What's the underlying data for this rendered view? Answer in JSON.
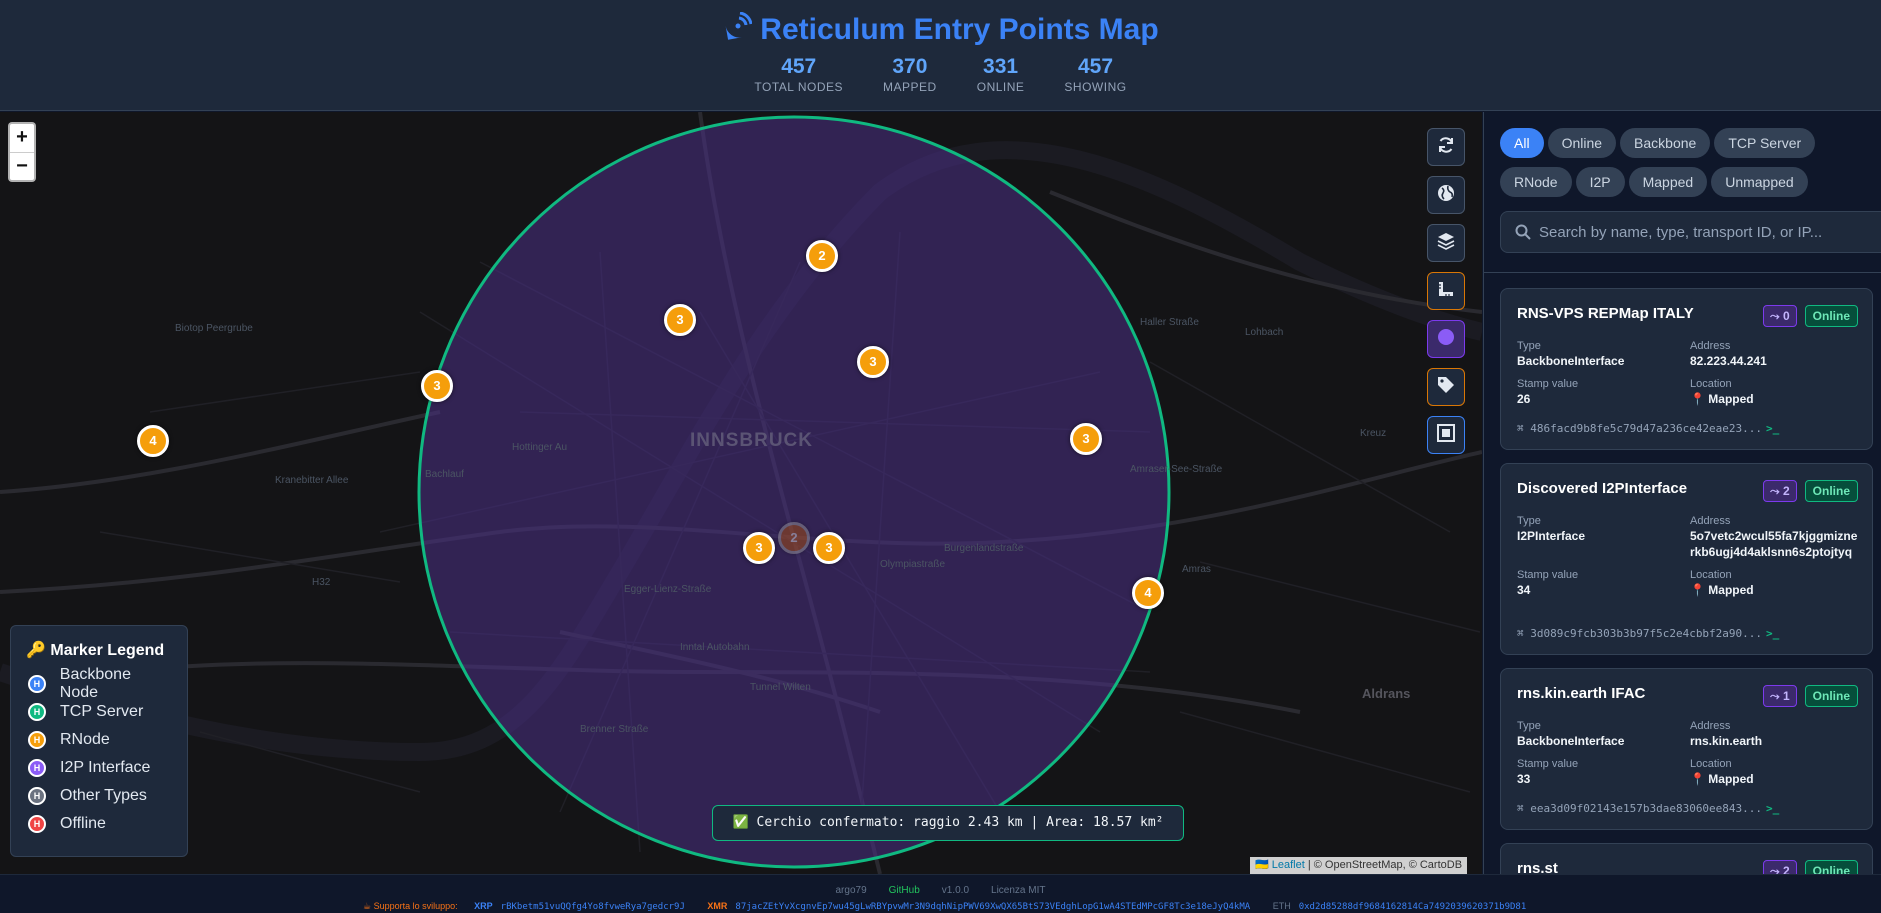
{
  "header": {
    "title": "Reticulum Entry Points Map",
    "stats": [
      {
        "value": "457",
        "label": "TOTAL NODES"
      },
      {
        "value": "370",
        "label": "MAPPED"
      },
      {
        "value": "331",
        "label": "ONLINE"
      },
      {
        "value": "457",
        "label": "SHOWING"
      }
    ]
  },
  "map": {
    "zoom_in": "+",
    "zoom_out": "−",
    "city_label": "INNSBRUCK",
    "street_labels": [
      "Biotop Peergrube",
      "Hottinger Au",
      "Bachlauf",
      "Kranebitter Allee",
      "H32",
      "Egger-Lienz-Straße",
      "Olympiastraße",
      "Burgenlandstraße",
      "Inntal Autobahn",
      "Tunnel Wilten",
      "Brenner Straße",
      "Amraser-See-Straße",
      "Haller Straße",
      "Aldrans",
      "Amras",
      "Lohbach",
      "Kreuz"
    ],
    "clusters": [
      "2",
      "3",
      "3",
      "3",
      "4",
      "3",
      "2",
      "3",
      "3",
      "4"
    ],
    "legend": {
      "title": "Marker Legend",
      "items": [
        {
          "label": "Backbone Node",
          "color": "#3b82f6"
        },
        {
          "label": "TCP Server",
          "color": "#10b981"
        },
        {
          "label": "RNode",
          "color": "#f59e0b"
        },
        {
          "label": "I2P Interface",
          "color": "#8b5cf6"
        },
        {
          "label": "Other Types",
          "color": "#6b7280"
        },
        {
          "label": "Offline",
          "color": "#ef4444"
        }
      ],
      "marker_letter": "H"
    },
    "toast": "✅ Cerchio confermato: raggio 2.43 km | Area: 18.57 km²",
    "attribution": {
      "leaflet": "Leaflet",
      "rest": "| © OpenStreetMap, © CartoDB"
    },
    "circle_color": "#10b981",
    "circle_fill": "#5b3a9e"
  },
  "sidebar": {
    "filters": [
      "All",
      "Online",
      "Backbone",
      "TCP Server",
      "RNode",
      "I2P",
      "Mapped",
      "Unmapped"
    ],
    "active_filter": "All",
    "search_placeholder": "Search by name, type, transport ID, or IP...",
    "labels": {
      "type": "Type",
      "address": "Address",
      "stamp": "Stamp value",
      "location": "Location"
    },
    "cards": [
      {
        "name": "RNS-VPS REPMap ITALY",
        "hops": "0",
        "status": "Online",
        "type": "BackboneInterface",
        "address": "82.223.44.241",
        "stamp": "26",
        "location": "📍 Mapped",
        "tid": "486facd9b8fe5c79d47a236ce42eae23..."
      },
      {
        "name": "Discovered I2PInterface",
        "hops": "2",
        "status": "Online",
        "type": "I2PInterface",
        "address": "5o7vetc2wcul55fa7kjggmiznerkb6ugj4d4aklsnn6s2ptojtyq",
        "stamp": "34",
        "location": "📍 Mapped",
        "tid": "3d089c9fcb303b3b97f5c2e4cbbf2a90..."
      },
      {
        "name": "rns.kin.earth IFAC",
        "hops": "1",
        "status": "Online",
        "type": "BackboneInterface",
        "address": "rns.kin.earth",
        "stamp": "33",
        "location": "📍 Mapped",
        "tid": "eea3d09f02143e157b3dae83060ee843..."
      },
      {
        "name": "rns.st",
        "hops": "2",
        "status": "Online"
      }
    ]
  },
  "footer": {
    "author": "argo79",
    "github": "GitHub",
    "version": "v1.0.0",
    "license": "Licenza MIT",
    "support": "☕ Supporta lo sviluppo:",
    "xrp_label": "XRP",
    "xrp_addr": "rBKbetm51vuQQfg4Yo8fvweRya7gedcr9J",
    "xmr_label": "XMR",
    "xmr_addr": "87jacZEtYvXcgnvEp7wu45gLwRBYpvwMr3N9dqhNipPWV69XwQX65BtS73VEdghLopG1wA4STEdMPcGF8Tc3e18eJyQ4kMA",
    "eth_label": "ETH",
    "eth_addr": "0xd2d85288df9684162814Ca7492039620371b9D81"
  }
}
